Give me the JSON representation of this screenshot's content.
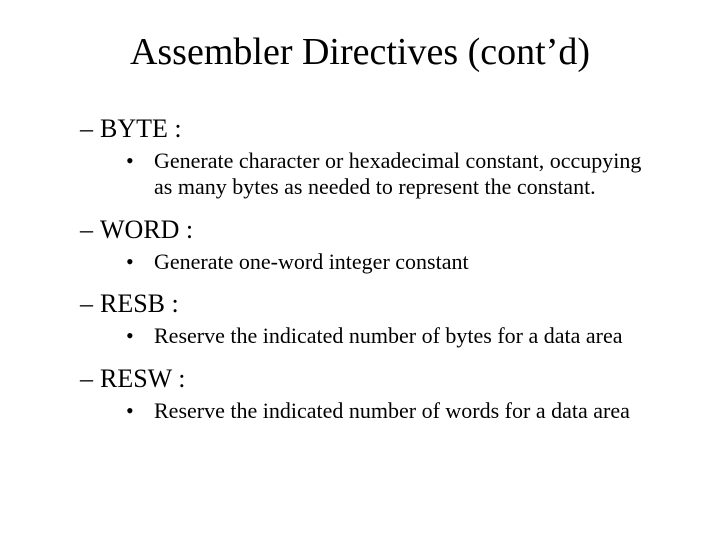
{
  "title": "Assembler Directives (cont’d)",
  "items": [
    {
      "term": "BYTE :",
      "desc": "Generate character or hexadecimal constant, occupying as many bytes as needed to represent the constant."
    },
    {
      "term": "WORD :",
      "desc": "Generate one-word integer constant"
    },
    {
      "term": "RESB :",
      "desc": "Reserve the indicated number of bytes for a data area"
    },
    {
      "term": "RESW :",
      "desc": "Reserve the indicated number of words for a data area"
    }
  ]
}
